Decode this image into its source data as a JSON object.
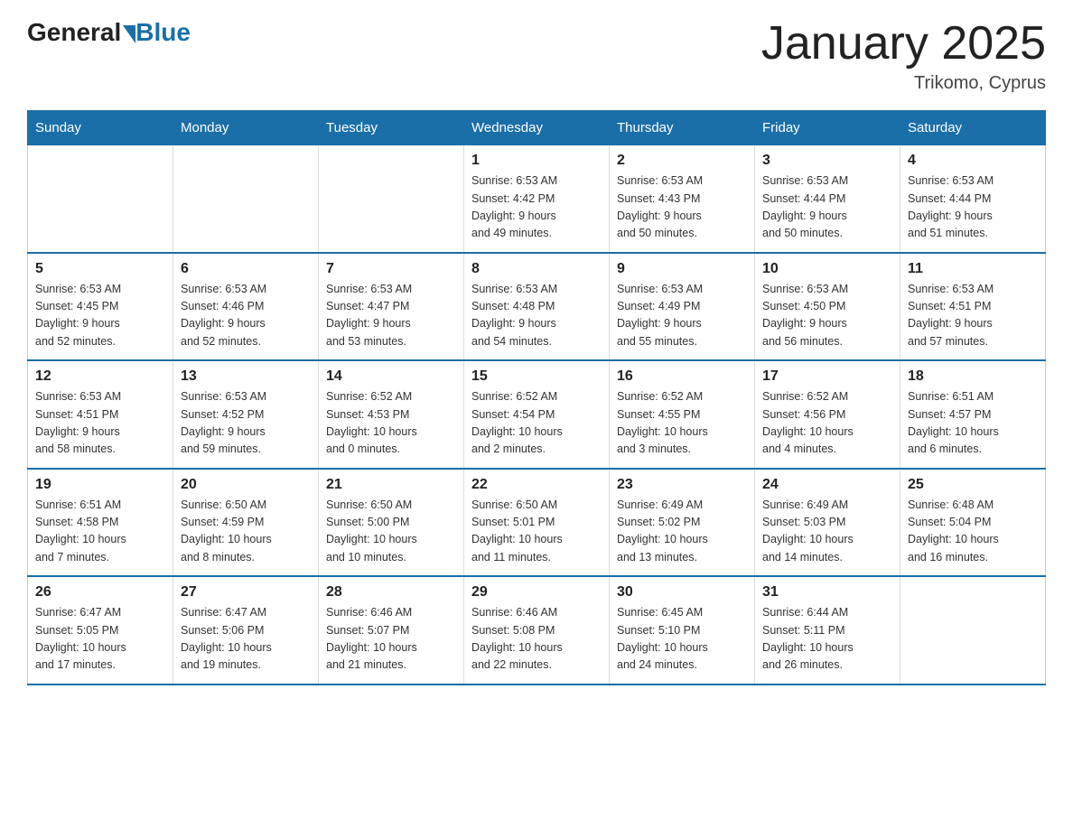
{
  "header": {
    "logo_general": "General",
    "logo_blue": "Blue",
    "title": "January 2025",
    "subtitle": "Trikomo, Cyprus"
  },
  "days_of_week": [
    "Sunday",
    "Monday",
    "Tuesday",
    "Wednesday",
    "Thursday",
    "Friday",
    "Saturday"
  ],
  "weeks": [
    [
      {
        "day": "",
        "info": ""
      },
      {
        "day": "",
        "info": ""
      },
      {
        "day": "",
        "info": ""
      },
      {
        "day": "1",
        "info": "Sunrise: 6:53 AM\nSunset: 4:42 PM\nDaylight: 9 hours\nand 49 minutes."
      },
      {
        "day": "2",
        "info": "Sunrise: 6:53 AM\nSunset: 4:43 PM\nDaylight: 9 hours\nand 50 minutes."
      },
      {
        "day": "3",
        "info": "Sunrise: 6:53 AM\nSunset: 4:44 PM\nDaylight: 9 hours\nand 50 minutes."
      },
      {
        "day": "4",
        "info": "Sunrise: 6:53 AM\nSunset: 4:44 PM\nDaylight: 9 hours\nand 51 minutes."
      }
    ],
    [
      {
        "day": "5",
        "info": "Sunrise: 6:53 AM\nSunset: 4:45 PM\nDaylight: 9 hours\nand 52 minutes."
      },
      {
        "day": "6",
        "info": "Sunrise: 6:53 AM\nSunset: 4:46 PM\nDaylight: 9 hours\nand 52 minutes."
      },
      {
        "day": "7",
        "info": "Sunrise: 6:53 AM\nSunset: 4:47 PM\nDaylight: 9 hours\nand 53 minutes."
      },
      {
        "day": "8",
        "info": "Sunrise: 6:53 AM\nSunset: 4:48 PM\nDaylight: 9 hours\nand 54 minutes."
      },
      {
        "day": "9",
        "info": "Sunrise: 6:53 AM\nSunset: 4:49 PM\nDaylight: 9 hours\nand 55 minutes."
      },
      {
        "day": "10",
        "info": "Sunrise: 6:53 AM\nSunset: 4:50 PM\nDaylight: 9 hours\nand 56 minutes."
      },
      {
        "day": "11",
        "info": "Sunrise: 6:53 AM\nSunset: 4:51 PM\nDaylight: 9 hours\nand 57 minutes."
      }
    ],
    [
      {
        "day": "12",
        "info": "Sunrise: 6:53 AM\nSunset: 4:51 PM\nDaylight: 9 hours\nand 58 minutes."
      },
      {
        "day": "13",
        "info": "Sunrise: 6:53 AM\nSunset: 4:52 PM\nDaylight: 9 hours\nand 59 minutes."
      },
      {
        "day": "14",
        "info": "Sunrise: 6:52 AM\nSunset: 4:53 PM\nDaylight: 10 hours\nand 0 minutes."
      },
      {
        "day": "15",
        "info": "Sunrise: 6:52 AM\nSunset: 4:54 PM\nDaylight: 10 hours\nand 2 minutes."
      },
      {
        "day": "16",
        "info": "Sunrise: 6:52 AM\nSunset: 4:55 PM\nDaylight: 10 hours\nand 3 minutes."
      },
      {
        "day": "17",
        "info": "Sunrise: 6:52 AM\nSunset: 4:56 PM\nDaylight: 10 hours\nand 4 minutes."
      },
      {
        "day": "18",
        "info": "Sunrise: 6:51 AM\nSunset: 4:57 PM\nDaylight: 10 hours\nand 6 minutes."
      }
    ],
    [
      {
        "day": "19",
        "info": "Sunrise: 6:51 AM\nSunset: 4:58 PM\nDaylight: 10 hours\nand 7 minutes."
      },
      {
        "day": "20",
        "info": "Sunrise: 6:50 AM\nSunset: 4:59 PM\nDaylight: 10 hours\nand 8 minutes."
      },
      {
        "day": "21",
        "info": "Sunrise: 6:50 AM\nSunset: 5:00 PM\nDaylight: 10 hours\nand 10 minutes."
      },
      {
        "day": "22",
        "info": "Sunrise: 6:50 AM\nSunset: 5:01 PM\nDaylight: 10 hours\nand 11 minutes."
      },
      {
        "day": "23",
        "info": "Sunrise: 6:49 AM\nSunset: 5:02 PM\nDaylight: 10 hours\nand 13 minutes."
      },
      {
        "day": "24",
        "info": "Sunrise: 6:49 AM\nSunset: 5:03 PM\nDaylight: 10 hours\nand 14 minutes."
      },
      {
        "day": "25",
        "info": "Sunrise: 6:48 AM\nSunset: 5:04 PM\nDaylight: 10 hours\nand 16 minutes."
      }
    ],
    [
      {
        "day": "26",
        "info": "Sunrise: 6:47 AM\nSunset: 5:05 PM\nDaylight: 10 hours\nand 17 minutes."
      },
      {
        "day": "27",
        "info": "Sunrise: 6:47 AM\nSunset: 5:06 PM\nDaylight: 10 hours\nand 19 minutes."
      },
      {
        "day": "28",
        "info": "Sunrise: 6:46 AM\nSunset: 5:07 PM\nDaylight: 10 hours\nand 21 minutes."
      },
      {
        "day": "29",
        "info": "Sunrise: 6:46 AM\nSunset: 5:08 PM\nDaylight: 10 hours\nand 22 minutes."
      },
      {
        "day": "30",
        "info": "Sunrise: 6:45 AM\nSunset: 5:10 PM\nDaylight: 10 hours\nand 24 minutes."
      },
      {
        "day": "31",
        "info": "Sunrise: 6:44 AM\nSunset: 5:11 PM\nDaylight: 10 hours\nand 26 minutes."
      },
      {
        "day": "",
        "info": ""
      }
    ]
  ]
}
